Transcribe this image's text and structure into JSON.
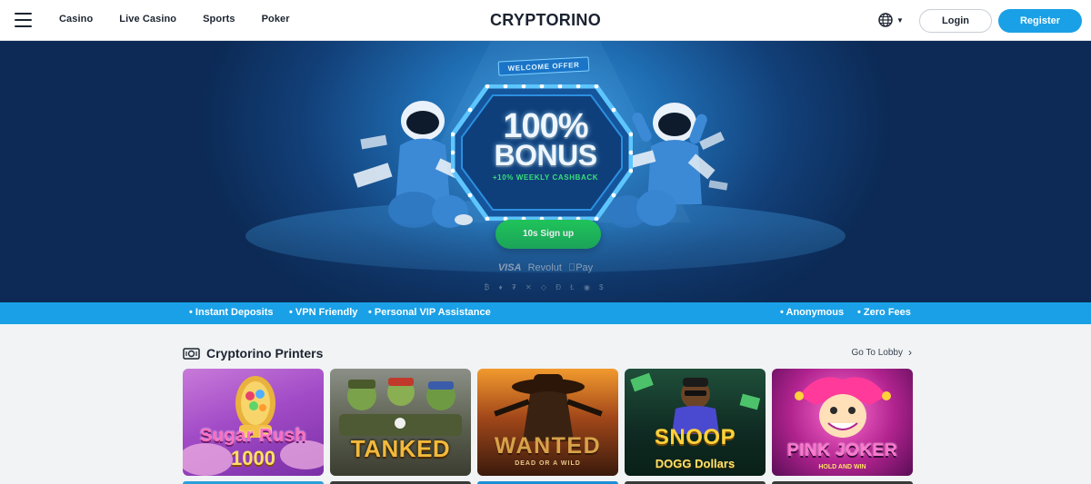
{
  "header": {
    "nav": [
      "Casino",
      "Live Casino",
      "Sports",
      "Poker"
    ],
    "logo": "CRYPTORINO",
    "login": "Login",
    "register": "Register"
  },
  "hero": {
    "welcome": "WELCOME OFFER",
    "bonus_pct": "100%",
    "bonus_word": "BONUS",
    "cashback": "+10% WEEKLY CASHBACK",
    "signup": "10s Sign up",
    "payments": {
      "visa": "VISA",
      "revolut": "Revolut",
      "apple_pay": "Pay"
    },
    "crypto_icons": "₿ ♦ ₮ ✕ ◇ Ð Ł ◉ $"
  },
  "ticker": {
    "left": [
      "Instant Deposits",
      "VPN Friendly",
      "Personal VIP Assistance"
    ],
    "right": [
      "Anonymous",
      "Zero Fees"
    ]
  },
  "section": {
    "title": "Cryptorino Printers",
    "lobby": "Go To Lobby"
  },
  "games": [
    {
      "title": "Sugar Rush",
      "sub": "1000"
    },
    {
      "title": "TANKED",
      "sub": ""
    },
    {
      "title": "WANTED",
      "sub": "DEAD OR A WILD"
    },
    {
      "title": "SNOOP",
      "sub": "DOGG Dollars"
    },
    {
      "title": "PINK JOKER",
      "sub": "HOLD AND WIN"
    }
  ],
  "colors": {
    "accent": "#1aa0e6",
    "cta": "#1fc15a",
    "hero_dark": "#0c2a55"
  }
}
